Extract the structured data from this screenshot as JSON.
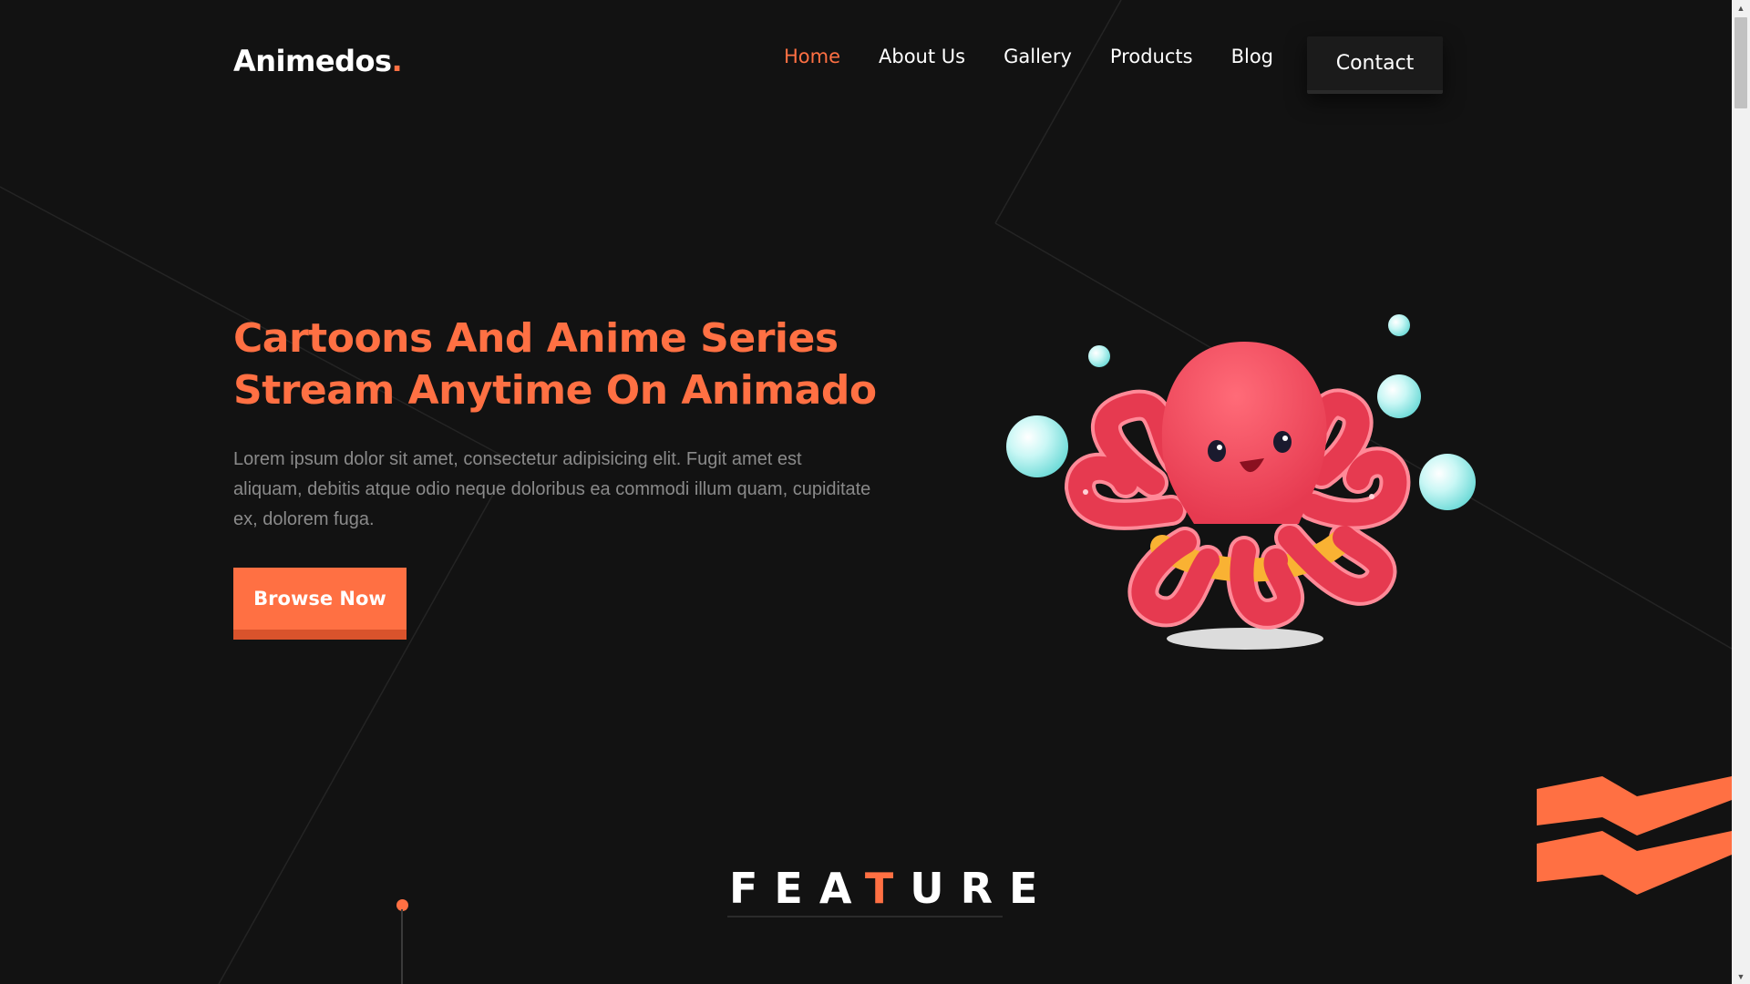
{
  "header": {
    "logo": "Animedos",
    "logo_dot": ".",
    "nav": [
      {
        "label": "Home",
        "active": true
      },
      {
        "label": "About Us"
      },
      {
        "label": "Gallery"
      },
      {
        "label": "Products"
      },
      {
        "label": "Blog"
      }
    ],
    "contact_label": "Contact"
  },
  "hero": {
    "title_line1": "Cartoons And Anime Series",
    "title_line2": "Stream Anytime On Animado",
    "description": "Lorem ipsum dolor sit amet, consectetur adipisicing elit. Fugit amet est aliquam, debitis atque odio neque doloribus ea commodi illum quam, cupiditate ex, dolorem fuga.",
    "browse_label": "Browse Now",
    "illustration": "octopus-illustration"
  },
  "feature": {
    "title_pre": "FEA",
    "title_highlight": "T",
    "title_post": "URE"
  },
  "icons": {
    "decor": "chevrons-decoration",
    "scroll_up": "scroll-up-arrow",
    "scroll_down": "scroll-down-arrow"
  },
  "colors": {
    "background": "#121212",
    "accent": "#ff7043",
    "accent_dark": "#d9532c",
    "text": "#ffffff",
    "muted_text": "#8a8a8a",
    "bubble": "#a8f0f0",
    "octopus": "#f0455a"
  }
}
